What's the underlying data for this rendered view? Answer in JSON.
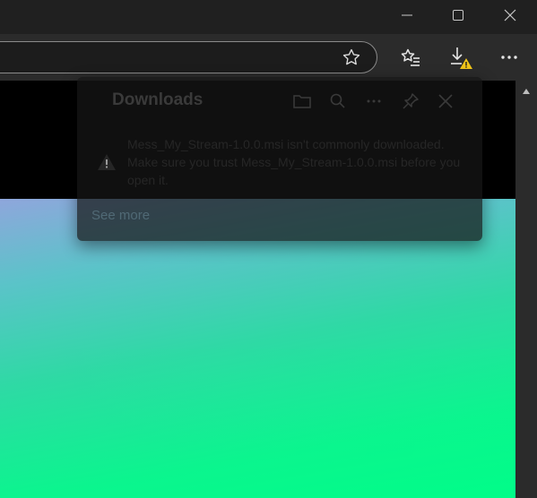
{
  "window": {
    "minimize_icon": "minimize-icon",
    "maximize_icon": "maximize-icon",
    "close_icon": "close-icon"
  },
  "toolbar": {
    "address_value": "",
    "favorite_icon": "star-icon",
    "favorites_icon": "favorites-list-icon",
    "downloads_icon": "download-warning-icon",
    "more_icon": "more-icon"
  },
  "downloads": {
    "title": "Downloads",
    "warning": "Mess_My_Stream-1.0.0.msi isn't commonly downloaded. Make sure you trust Mess_My_Stream-1.0.0.msi before you open it.",
    "see_more": "See more"
  },
  "colors": {
    "accent_warning": "#f0c419",
    "hero_top": "#8fa6dc",
    "hero_bottom": "#00fd88"
  }
}
